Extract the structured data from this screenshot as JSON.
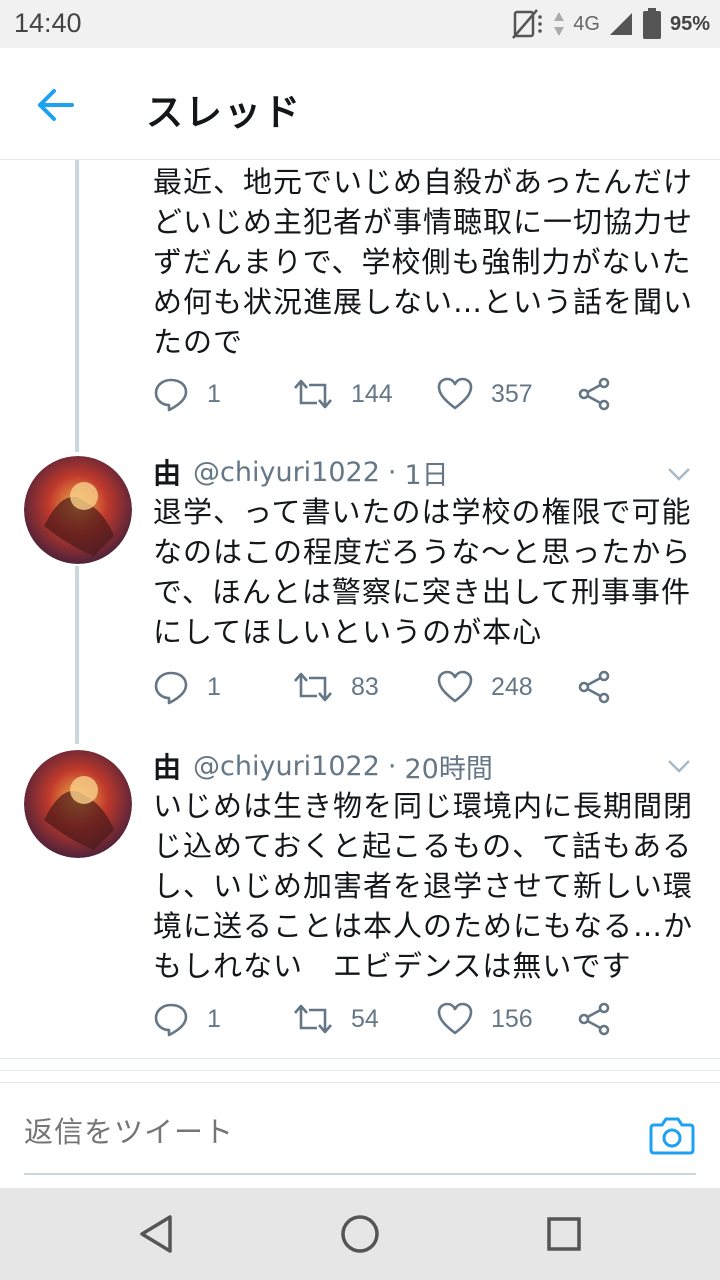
{
  "status_bar": {
    "time": "14:40",
    "network": "4G",
    "battery": "95%"
  },
  "app_bar": {
    "title": "スレッド",
    "back_icon": "arrow-left-icon"
  },
  "tweets": [
    {
      "text": "最近、地元でいじめ自殺があったんだけ\nどいじめ主犯者が事情聴取に一切協力せ\nずだんまりで、学校側も強制力がないた\nめ何も状況進展しない…という話を聞い\nたので",
      "replies": "1",
      "retweets": "144",
      "likes": "357"
    },
    {
      "name": "由",
      "handle": "@chiyuri1022",
      "sep": "·",
      "time": "1日",
      "text": "退学、って書いたのは学校の権限で可能\nなのはこの程度だろうな〜と思ったから\nで、ほんとは警察に突き出して刑事事件\nにしてほしいというのが本心",
      "replies": "1",
      "retweets": "83",
      "likes": "248"
    },
    {
      "name": "由",
      "handle": "@chiyuri1022",
      "sep": "·",
      "time": "20時間",
      "text": "いじめは生き物を同じ環境内に長期間閉\nじ込めておくと起こるもの、て話もある\nし、いじめ加害者を退学させて新しい環\n境に送ることは本人のためにもなる…か\nもしれない　エビデンスは無いです",
      "replies": "1",
      "retweets": "54",
      "likes": "156"
    }
  ],
  "reply_bar": {
    "placeholder": "返信をツイート",
    "camera_icon": "camera-icon"
  },
  "colors": {
    "accent": "#1da1f2",
    "secondary_text": "#657786",
    "thread_line": "#ccd6dd"
  },
  "nav_bar": {
    "icons": [
      "back-triangle-icon",
      "home-circle-icon",
      "recents-square-icon"
    ]
  }
}
